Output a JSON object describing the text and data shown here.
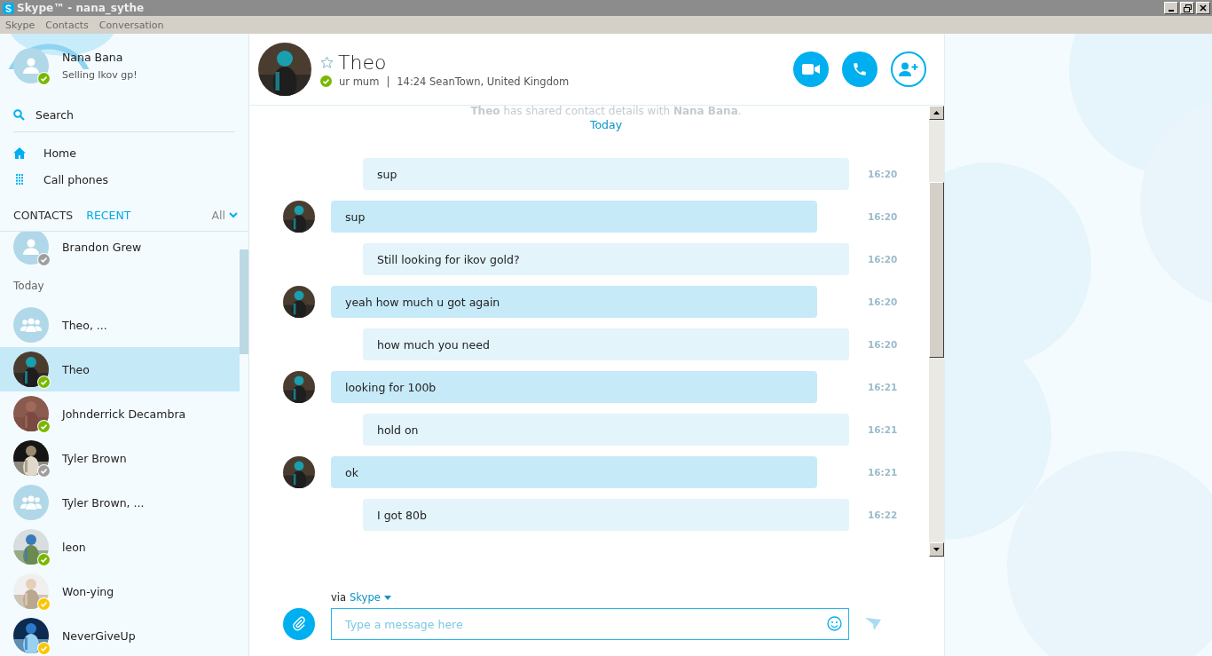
{
  "window": {
    "title": "Skype™ - nana_sythe"
  },
  "menu": [
    "Skype",
    "Contacts",
    "Conversation"
  ],
  "profile": {
    "name": "Nana Bana",
    "mood": "Selling Ikov gp!",
    "color": "#7ab800"
  },
  "search": {
    "label": "Search"
  },
  "nav": [
    {
      "kind": "home",
      "label": "Home"
    },
    {
      "kind": "dialpad",
      "label": "Call phones"
    }
  ],
  "tabs": [
    {
      "label": "CONTACTS",
      "selected": false
    },
    {
      "label": "RECENT",
      "selected": true
    }
  ],
  "filter": {
    "label": "All"
  },
  "contacts": [
    {
      "kind": "person",
      "name": "Brandon Grew",
      "color": "#9e9e9e",
      "selected": false
    },
    {
      "kind": "header",
      "name": "Today"
    },
    {
      "kind": "group",
      "name": "Theo, ...",
      "selected": false
    },
    {
      "name": "Theo",
      "color": "#7ab800",
      "selected": true
    },
    {
      "name": "Johnderrick Decambra",
      "color": "#7ab800",
      "selected": false
    },
    {
      "name": "Tyler Brown",
      "color": "#9e9e9e",
      "selected": false
    },
    {
      "kind": "group",
      "name": "Tyler Brown, ...",
      "selected": false
    },
    {
      "name": "leon",
      "color": "#7ab800",
      "selected": false
    },
    {
      "name": "Won-ying",
      "color": "#fdc500",
      "selected": false
    },
    {
      "name": "NeverGiveUp",
      "color": "#fdc500",
      "selected": false
    }
  ],
  "chat": {
    "name": "Theo",
    "color": "#7ab800",
    "mood": "ur mum",
    "separator": "|",
    "details": "14:24 SeanTown, United Kingdom",
    "notice": "**Theo** has shared contact details with **Nana Bana**.",
    "day": "Today",
    "messages": [
      {
        "kind": "sent",
        "text": "sup",
        "time": "16:20"
      },
      {
        "kind": "received",
        "text": "sup",
        "time": "16:20"
      },
      {
        "kind": "sent",
        "text": "Still looking for ikov gold?",
        "time": "16:20"
      },
      {
        "kind": "received",
        "text": "yeah how much u got again",
        "time": "16:20"
      },
      {
        "kind": "sent",
        "text": "how much you need",
        "time": "16:20"
      },
      {
        "kind": "received",
        "text": "looking for 100b",
        "time": "16:21"
      },
      {
        "kind": "sent",
        "text": "hold on",
        "time": "16:21"
      },
      {
        "kind": "received",
        "text": "ok",
        "time": "16:21"
      },
      {
        "kind": "sent",
        "text": "I got 80b",
        "time": "16:22"
      }
    ],
    "via": "via",
    "via_service": "Skype",
    "placeholder": "Type a message here"
  }
}
